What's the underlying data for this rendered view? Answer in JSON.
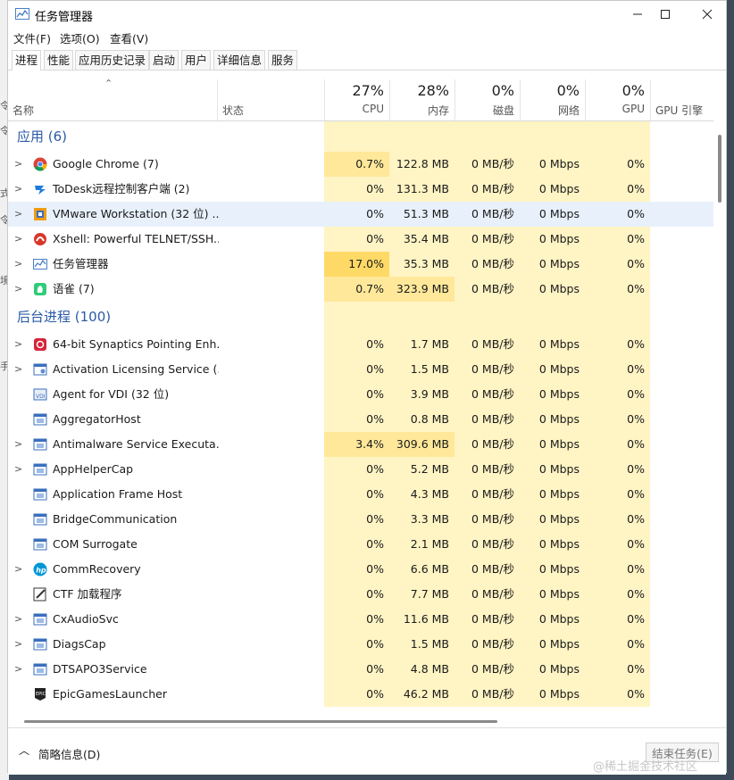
{
  "window": {
    "title": "任务管理器"
  },
  "menu": [
    "文件(F)",
    "选项(O)",
    "查看(V)"
  ],
  "tabs": [
    "进程",
    "性能",
    "应用历史记录",
    "启动",
    "用户",
    "详细信息",
    "服务"
  ],
  "header": {
    "name": "名称",
    "status": "状态",
    "cpu_pct": "27%",
    "cpu": "CPU",
    "mem_pct": "28%",
    "mem": "内存",
    "disk_pct": "0%",
    "disk": "磁盘",
    "net_pct": "0%",
    "net": "网络",
    "gpu_pct": "0%",
    "gpu": "GPU",
    "gpu_engine": "GPU 引擎"
  },
  "groups": {
    "apps": "应用 (6)",
    "background": "后台进程 (100)"
  },
  "apps": [
    {
      "name": "Google Chrome (7)",
      "cpu": "0.7%",
      "mem": "122.8 MB",
      "disk": "0 MB/秒",
      "net": "0 Mbps",
      "gpu": "0%",
      "icon": "chrome-icon"
    },
    {
      "name": "ToDesk远程控制客户端 (2)",
      "cpu": "0%",
      "mem": "131.3 MB",
      "disk": "0 MB/秒",
      "net": "0 Mbps",
      "gpu": "0%",
      "icon": "todesk-icon"
    },
    {
      "name": "VMware Workstation (32 位) ...",
      "cpu": "0%",
      "mem": "51.3 MB",
      "disk": "0 MB/秒",
      "net": "0 Mbps",
      "gpu": "0%",
      "icon": "vmware-icon"
    },
    {
      "name": "Xshell: Powerful TELNET/SSH...",
      "cpu": "0%",
      "mem": "35.4 MB",
      "disk": "0 MB/秒",
      "net": "0 Mbps",
      "gpu": "0%",
      "icon": "xshell-icon"
    },
    {
      "name": "任务管理器",
      "cpu": "17.0%",
      "mem": "35.3 MB",
      "disk": "0 MB/秒",
      "net": "0 Mbps",
      "gpu": "0%",
      "icon": "task-manager-icon"
    },
    {
      "name": "语雀 (7)",
      "cpu": "0.7%",
      "mem": "323.9 MB",
      "disk": "0 MB/秒",
      "net": "0 Mbps",
      "gpu": "0%",
      "icon": "yuque-icon"
    }
  ],
  "background": [
    {
      "name": "64-bit Synaptics Pointing Enh...",
      "cpu": "0%",
      "mem": "1.7 MB",
      "disk": "0 MB/秒",
      "net": "0 Mbps",
      "gpu": "0%",
      "icon": "synaptics-icon",
      "expand": true
    },
    {
      "name": "Activation Licensing Service (...",
      "cpu": "0%",
      "mem": "1.5 MB",
      "disk": "0 MB/秒",
      "net": "0 Mbps",
      "gpu": "0%",
      "icon": "service-icon",
      "expand": true
    },
    {
      "name": "Agent for VDI (32 位)",
      "cpu": "0%",
      "mem": "3.9 MB",
      "disk": "0 MB/秒",
      "net": "0 Mbps",
      "gpu": "0%",
      "icon": "vdi-icon",
      "expand": false
    },
    {
      "name": "AggregatorHost",
      "cpu": "0%",
      "mem": "0.8 MB",
      "disk": "0 MB/秒",
      "net": "0 Mbps",
      "gpu": "0%",
      "icon": "process-icon",
      "expand": false
    },
    {
      "name": "Antimalware Service Executa...",
      "cpu": "3.4%",
      "mem": "309.6 MB",
      "disk": "0 MB/秒",
      "net": "0 Mbps",
      "gpu": "0%",
      "icon": "process-icon",
      "expand": true
    },
    {
      "name": "AppHelperCap",
      "cpu": "0%",
      "mem": "5.2 MB",
      "disk": "0 MB/秒",
      "net": "0 Mbps",
      "gpu": "0%",
      "icon": "process-icon",
      "expand": true
    },
    {
      "name": "Application Frame Host",
      "cpu": "0%",
      "mem": "4.3 MB",
      "disk": "0 MB/秒",
      "net": "0 Mbps",
      "gpu": "0%",
      "icon": "process-icon",
      "expand": false
    },
    {
      "name": "BridgeCommunication",
      "cpu": "0%",
      "mem": "3.3 MB",
      "disk": "0 MB/秒",
      "net": "0 Mbps",
      "gpu": "0%",
      "icon": "process-icon",
      "expand": false
    },
    {
      "name": "COM Surrogate",
      "cpu": "0%",
      "mem": "2.1 MB",
      "disk": "0 MB/秒",
      "net": "0 Mbps",
      "gpu": "0%",
      "icon": "process-icon",
      "expand": false
    },
    {
      "name": "CommRecovery",
      "cpu": "0%",
      "mem": "6.6 MB",
      "disk": "0 MB/秒",
      "net": "0 Mbps",
      "gpu": "0%",
      "icon": "hp-icon",
      "expand": true
    },
    {
      "name": "CTF 加载程序",
      "cpu": "0%",
      "mem": "7.7 MB",
      "disk": "0 MB/秒",
      "net": "0 Mbps",
      "gpu": "0%",
      "icon": "ctf-icon",
      "expand": false
    },
    {
      "name": "CxAudioSvc",
      "cpu": "0%",
      "mem": "11.6 MB",
      "disk": "0 MB/秒",
      "net": "0 Mbps",
      "gpu": "0%",
      "icon": "process-icon",
      "expand": true
    },
    {
      "name": "DiagsCap",
      "cpu": "0%",
      "mem": "1.5 MB",
      "disk": "0 MB/秒",
      "net": "0 Mbps",
      "gpu": "0%",
      "icon": "process-icon",
      "expand": true
    },
    {
      "name": "DTSAPO3Service",
      "cpu": "0%",
      "mem": "4.8 MB",
      "disk": "0 MB/秒",
      "net": "0 Mbps",
      "gpu": "0%",
      "icon": "process-icon",
      "expand": true
    },
    {
      "name": "EpicGamesLauncher",
      "cpu": "0%",
      "mem": "46.2 MB",
      "disk": "0 MB/秒",
      "net": "0 Mbps",
      "gpu": "0%",
      "icon": "epic-icon",
      "expand": false
    }
  ],
  "footer": {
    "less_details": "简略信息(D)",
    "end_task": "结束任务(E)"
  },
  "watermark": "@稀土掘金技术社区"
}
